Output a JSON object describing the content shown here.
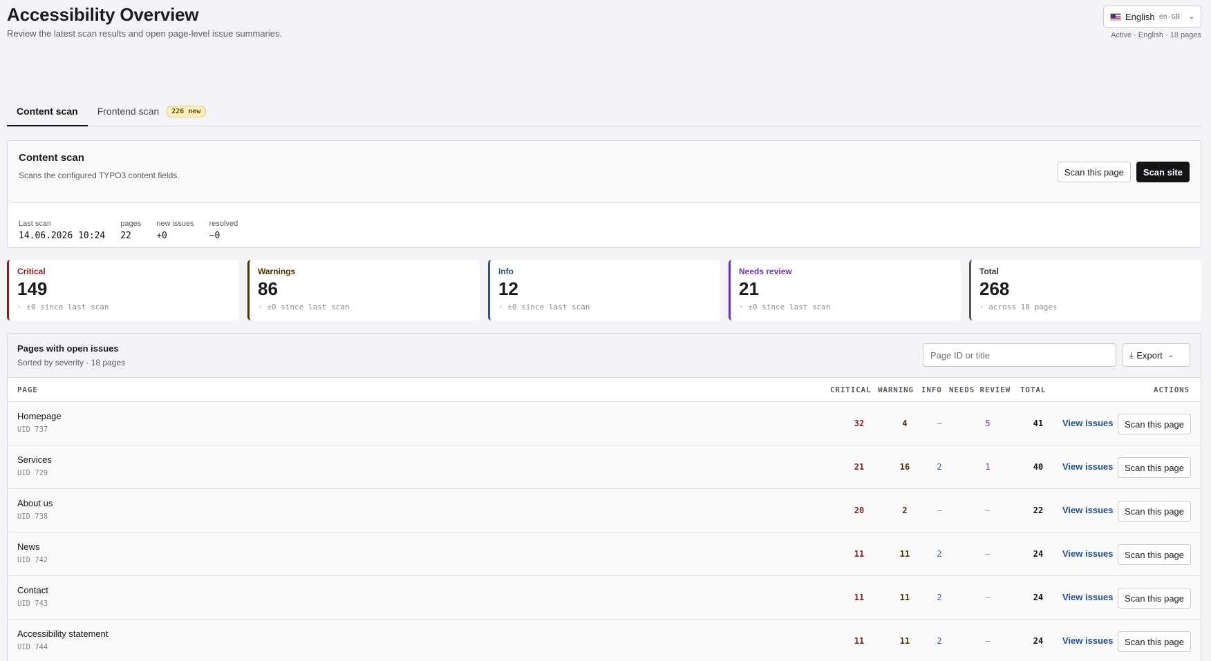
{
  "header": {
    "title": "Accessibility Overview",
    "subtitle": "Review the latest scan results and open page-level issue summaries."
  },
  "language": {
    "label": "English",
    "code": "en-GB",
    "status": "Active · English · 18 pages"
  },
  "tabs": [
    {
      "label": "Content scan",
      "active": true
    },
    {
      "label": "Frontend scan",
      "badge": "226 new"
    }
  ],
  "scan_panel": {
    "title": "Content scan",
    "description": "Scans the configured TYPO3 content fields.",
    "scan_page_label": "Scan this page",
    "scan_site_label": "Scan site",
    "meta": [
      {
        "key": "Last scan",
        "value": "14.06.2026 10:24"
      },
      {
        "key": "pages",
        "value": "22"
      },
      {
        "key": "new issues",
        "value": "+0"
      },
      {
        "key": "resolved",
        "value": "−0"
      }
    ]
  },
  "stats": [
    {
      "label": "Critical",
      "value": "149",
      "sub": "· ±0 since last scan",
      "color": "#8b1c1c"
    },
    {
      "label": "Warnings",
      "value": "86",
      "sub": "· ±0 since last scan",
      "color": "#4a3200"
    },
    {
      "label": "Info",
      "value": "12",
      "sub": "· ±0 since last scan",
      "color": "#2f4f7f"
    },
    {
      "label": "Needs review",
      "value": "21",
      "sub": "· ±0 since last scan",
      "color": "#6a2fc9"
    },
    {
      "label": "Total",
      "value": "268",
      "sub": "· across 18 pages",
      "color": "#555555"
    }
  ],
  "table": {
    "title": "Pages with open issues",
    "subtitle": "Sorted by severity · 18 pages",
    "search_placeholder": "Page ID or title",
    "export_label": "Export",
    "columns": {
      "page": "PAGE",
      "critical": "CRITICAL",
      "warning": "WARNING",
      "info": "INFO",
      "review": "NEEDS REVIEW",
      "total": "TOTAL",
      "actions": "ACTIONS"
    },
    "view_label": "View issues",
    "scan_label": "Scan this page",
    "rows": [
      {
        "name": "Homepage",
        "uid": "UID 737",
        "critical": "32",
        "warning": "4",
        "info": "–",
        "review": "5",
        "total": "41"
      },
      {
        "name": "Services",
        "uid": "UID 729",
        "critical": "21",
        "warning": "16",
        "info": "2",
        "review": "1",
        "total": "40"
      },
      {
        "name": "About us",
        "uid": "UID 738",
        "critical": "20",
        "warning": "2",
        "info": "–",
        "review": "–",
        "total": "22"
      },
      {
        "name": "News",
        "uid": "UID 742",
        "critical": "11",
        "warning": "11",
        "info": "2",
        "review": "–",
        "total": "24"
      },
      {
        "name": "Contact",
        "uid": "UID 743",
        "critical": "11",
        "warning": "11",
        "info": "2",
        "review": "–",
        "total": "24"
      },
      {
        "name": "Accessibility statement",
        "uid": "UID 744",
        "critical": "11",
        "warning": "11",
        "info": "2",
        "review": "–",
        "total": "24"
      }
    ]
  }
}
